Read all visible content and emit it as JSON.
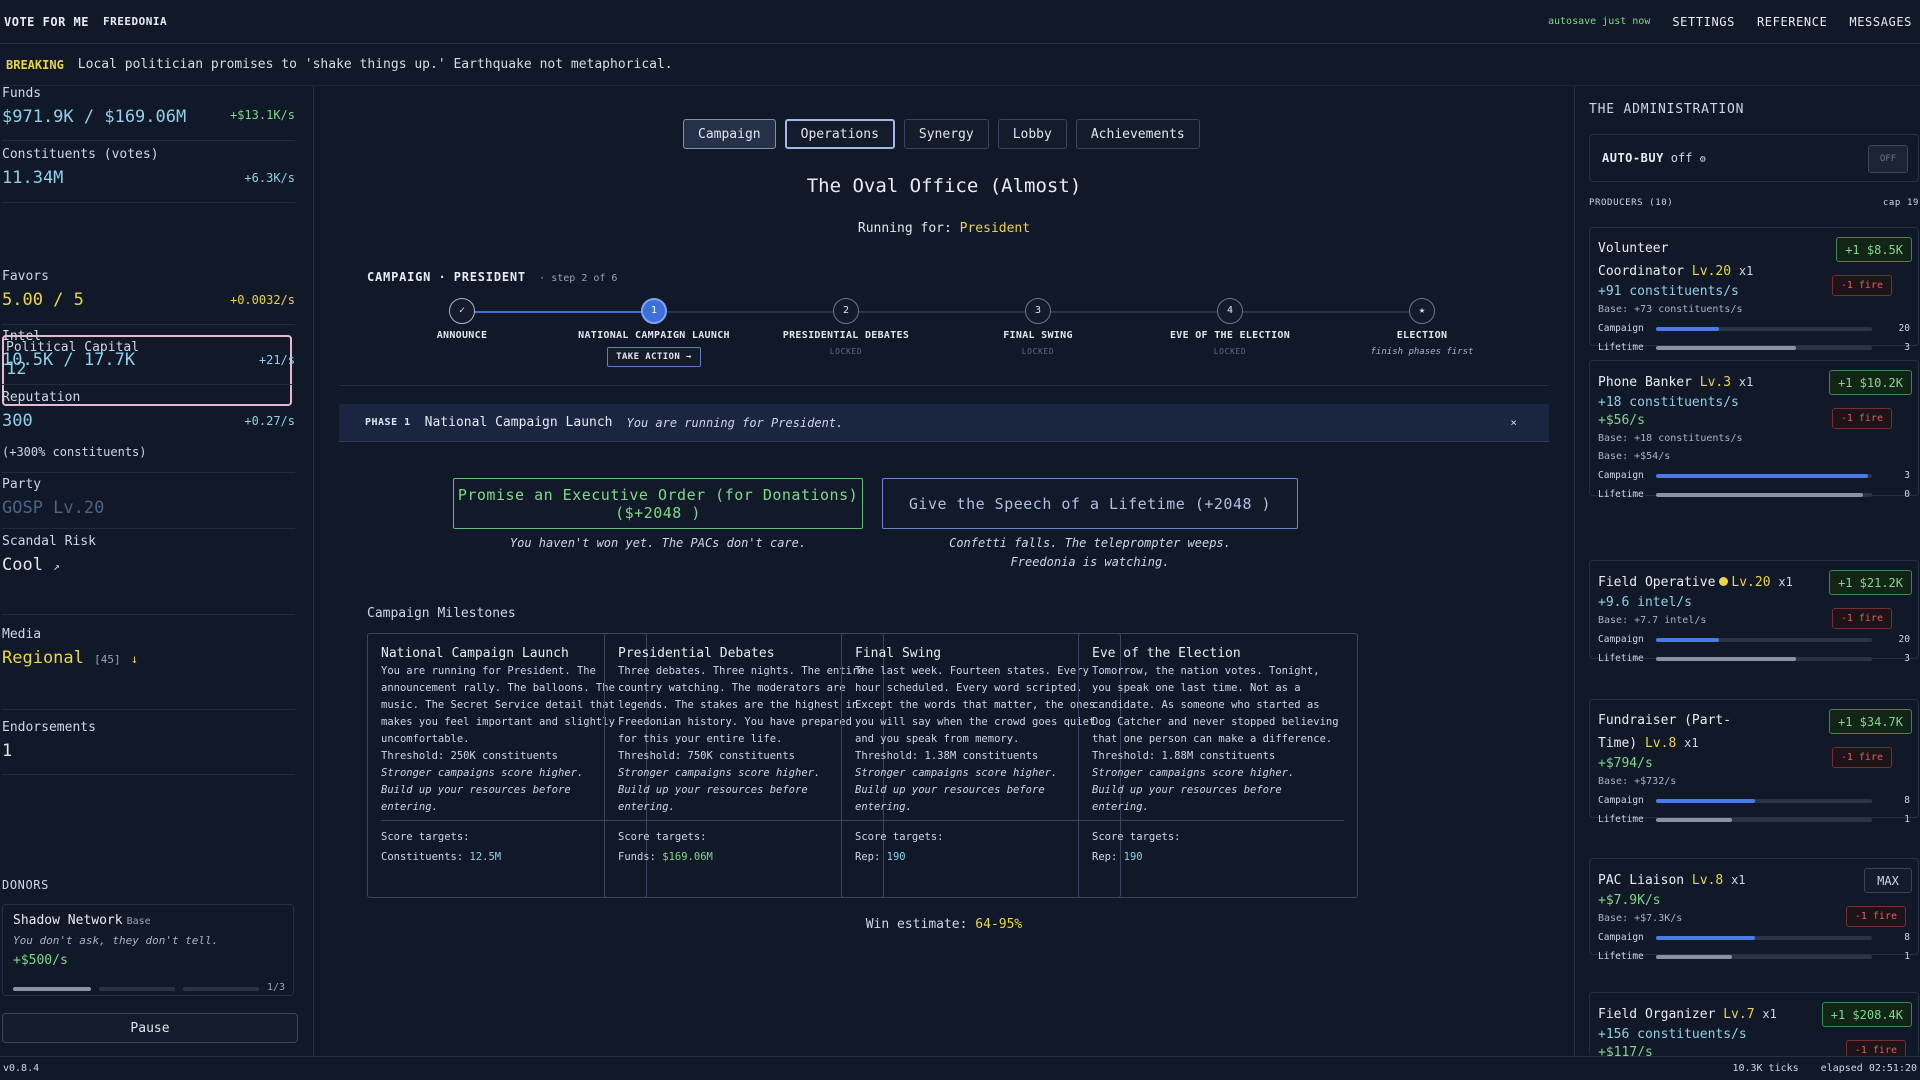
{
  "header": {
    "brand": "VOTE FOR ME",
    "country": "FREEDONIA",
    "autosave": "autosave just now",
    "nav": [
      "SETTINGS",
      "REFERENCE",
      "MESSAGES"
    ]
  },
  "breaking": {
    "tag": "BREAKING",
    "text": "Local politician promises to 'shake things up.' Earthquake not metaphorical."
  },
  "stats": {
    "funds": {
      "label": "Funds",
      "value": "$971.9K / $169.06M",
      "rate": "+$13.1K/s"
    },
    "constituents": {
      "label": "Constituents (votes)",
      "value": "11.34M",
      "rate": "+6.3K/s"
    },
    "political_capital": {
      "label": "Political Capital",
      "value": "12"
    },
    "favors": {
      "label": "Favors",
      "value": "5.00 / 5",
      "rate": "+0.0032/s"
    },
    "intel": {
      "label": "Intel",
      "value": "10.5K / 17.7K",
      "rate": "+21/s"
    },
    "reputation": {
      "label": "Reputation",
      "value": "300",
      "rate": "+0.27/s",
      "note": "(+300% constituents)"
    },
    "party": {
      "label": "Party",
      "value": "GOSP Lv.20"
    },
    "scandal": {
      "label": "Scandal Risk",
      "value": "Cool",
      "icon": "arrow-up-right-icon"
    },
    "media": {
      "label": "Media",
      "value": "Regional",
      "count": "[45]",
      "trend": "↓"
    },
    "endorsements": {
      "label": "Endorsements",
      "value": "1"
    }
  },
  "donors": {
    "title": "DONORS",
    "items": [
      {
        "name": "Shadow Network",
        "tier": "Base",
        "desc": "You don't ask, they don't tell.",
        "rate": "+$500/s",
        "progress": "1/3",
        "filled": 1,
        "total": 3
      }
    ]
  },
  "pause_label": "Pause",
  "tabs": [
    {
      "label": "Campaign",
      "active": true
    },
    {
      "label": "Operations",
      "focused": true
    },
    {
      "label": "Synergy"
    },
    {
      "label": "Lobby"
    },
    {
      "label": "Achievements"
    }
  ],
  "office": {
    "title": "The Oval Office (Almost)",
    "running_prefix": "Running for:",
    "running_value": "President"
  },
  "campaign": {
    "head": "CAMPAIGN",
    "sep": "·",
    "office": "PRESIDENT",
    "step_text": "· step 2 of 6",
    "progress": 0.2,
    "take_action": "TAKE ACTION →",
    "steps": [
      {
        "dot": "✓",
        "label": "ANNOUNCE",
        "sub": "",
        "state": "done"
      },
      {
        "dot": "1",
        "label": "NATIONAL CAMPAIGN LAUNCH",
        "sub": "",
        "state": "current"
      },
      {
        "dot": "2",
        "label": "PRESIDENTIAL DEBATES",
        "sub": "LOCKED",
        "state": "locked"
      },
      {
        "dot": "3",
        "label": "FINAL SWING",
        "sub": "LOCKED",
        "state": "locked"
      },
      {
        "dot": "4",
        "label": "EVE OF THE ELECTION",
        "sub": "LOCKED",
        "state": "locked"
      },
      {
        "dot": "★",
        "label": "ELECTION",
        "sub": "finish phases first",
        "state": "final"
      }
    ]
  },
  "phase": {
    "tag": "PHASE 1",
    "name": "National Campaign Launch",
    "desc": "You are running for President.",
    "close": "×"
  },
  "actions": [
    {
      "label": "Promise an Executive Order (for Donations) ($+2048 )",
      "flavor": "You haven't won yet. The PACs don't care."
    },
    {
      "label": "Give the Speech of a Lifetime (+2048 )",
      "flavor": "Confetti falls. The teleprompter weeps.",
      "flavor2": "Freedonia is watching."
    }
  ],
  "milestones": {
    "title": "Campaign Milestones",
    "score_label": "Score targets:",
    "hint1": "Stronger campaigns score higher.",
    "hint2": "Build up your resources before entering.",
    "items": [
      {
        "title": "National Campaign Launch",
        "body": "You are running for President. The announcement rally. The balloons. The music. The Secret Service detail that makes you feel important and slightly uncomfortable.",
        "threshold": "Threshold: 250K constituents",
        "target_label": "Constituents:",
        "target_value": "12.5M"
      },
      {
        "title": "Presidential Debates",
        "body": "Three debates. Three nights. The entire country watching. The moderators are legends. The stakes are the highest in Freedonian history. You have prepared for this your entire life.",
        "threshold": "Threshold: 750K constituents",
        "target_label": "Funds:",
        "target_value": "$169.06M"
      },
      {
        "title": "Final Swing",
        "body": "The last week. Fourteen states. Every hour scheduled. Every word scripted. Except the words that matter, the ones you will say when the crowd goes quiet and you speak from memory.",
        "threshold": "Threshold: 1.38M constituents",
        "target_label": "Rep:",
        "target_value": "190"
      },
      {
        "title": "Eve of the Election",
        "body": "Tomorrow, the nation votes. Tonight, you speak one last time. Not as a candidate. As someone who started as Dog Catcher and never stopped believing that one person can make a difference.",
        "threshold": "Threshold: 1.88M constituents",
        "target_label": "Rep:",
        "target_value": "190"
      }
    ]
  },
  "win": {
    "label": "Win estimate:",
    "value": "64-95%"
  },
  "admin": {
    "title": "THE ADMINISTRATION",
    "autobuy_label": "AUTO-BUY",
    "autobuy_state": "off",
    "autobuy_icon": "gear-icon",
    "autobuy_toggle": "OFF",
    "producers_label": "PRODUCERS (10)",
    "cap_label": "cap 19",
    "fire_label": "-1 fire",
    "campaign_label": "Campaign",
    "lifetime_label": "Lifetime",
    "producers": [
      {
        "name1": "Volunteer",
        "name2": "Coordinator",
        "lv": "Lv.20",
        "mul": "x1",
        "out1": "+91 constituents/s",
        "out2": "",
        "base1": "Base: +73 constituents/s",
        "base2": "",
        "buy": "+1 $8.5K",
        "campaign": "20",
        "campaign_fill": 0.29,
        "lifetime": "3",
        "lifetime_fill": 0.65
      },
      {
        "name1": "Phone Banker",
        "lv": "Lv.3",
        "mul": "x1",
        "out1": "+18 constituents/s",
        "out2": "+$56/s",
        "base1": "Base: +18 constituents/s",
        "base2": "Base: +$54/s",
        "buy": "+1 $10.2K",
        "campaign": "3",
        "campaign_fill": 0.98,
        "lifetime": "0",
        "lifetime_fill": 0.96
      },
      {
        "name1": "Field Operative",
        "lv": "Lv.20",
        "mul": "x1",
        "out1": "+9.6 intel/s",
        "out2": "",
        "base1": "Base: +7.7 intel/s",
        "base2": "",
        "buy": "+1 $21.2K",
        "campaign": "20",
        "campaign_fill": 0.29,
        "lifetime": "3",
        "lifetime_fill": 0.65
      },
      {
        "name1": "Fundraiser (Part-",
        "name2": "Time)",
        "lv": "Lv.8",
        "mul": "x1",
        "out1": "+$794/s",
        "out2": "",
        "base1": "Base: +$732/s",
        "base2": "",
        "buy": "+1 $34.7K",
        "campaign": "8",
        "campaign_fill": 0.46,
        "lifetime": "1",
        "lifetime_fill": 0.35
      },
      {
        "name1": "PAC Liaison",
        "lv": "Lv.8",
        "mul": "x1",
        "out1": "+$7.9K/s",
        "out2": "",
        "base1": "Base: +$7.3K/s",
        "base2": "",
        "buy": "MAX",
        "campaign": "8",
        "campaign_fill": 0.46,
        "lifetime": "1",
        "lifetime_fill": 0.35
      },
      {
        "name1": "Field Organizer",
        "lv": "Lv.7",
        "mul": "x1",
        "out1": "+156 constituents/s",
        "out2": "+$117/s",
        "base1": "",
        "base2": "",
        "buy": "+1 $208.4K",
        "campaign": "",
        "lifetime": ""
      }
    ]
  },
  "footer": {
    "version": "v0.8.4",
    "ticks": "10.3K ticks",
    "elapsed": "elapsed 02:51:20"
  }
}
